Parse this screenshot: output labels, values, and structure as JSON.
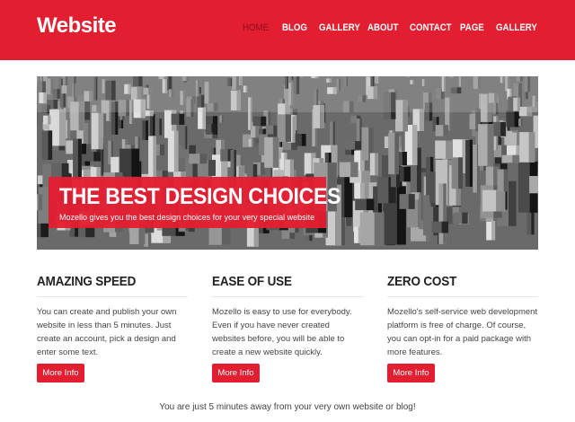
{
  "brand": {
    "logo": "Website",
    "accent": "#e31e31"
  },
  "nav": {
    "items": [
      "HOME",
      "BLOG",
      "GALLERY",
      "ABOUT",
      "CONTACT",
      "PAGE",
      "GALLERY"
    ],
    "active": "HOME"
  },
  "hero": {
    "title": "THE BEST DESIGN CHOICES",
    "subtitle": "Mozello gives you the best design choices for your very special website"
  },
  "features": [
    {
      "title": "AMAZING SPEED",
      "text": "You can create and publish your own website in less than 5 minutes. Just create an account, pick a design and enter some text.",
      "button": "More Info"
    },
    {
      "title": "EASE OF USE",
      "text": "Mozello is easy to use for everybody. Even if you have never created websites before, you will be able to create a new website quickly.",
      "button": "More Info"
    },
    {
      "title": "ZERO COST",
      "text": "Mozello's self-service web development platform is free of charge. Of course, you can opt-in for a paid package with more features.",
      "button": "More Info"
    }
  ],
  "footer": {
    "text": "You are just 5 minutes away from your very own website or blog!"
  }
}
